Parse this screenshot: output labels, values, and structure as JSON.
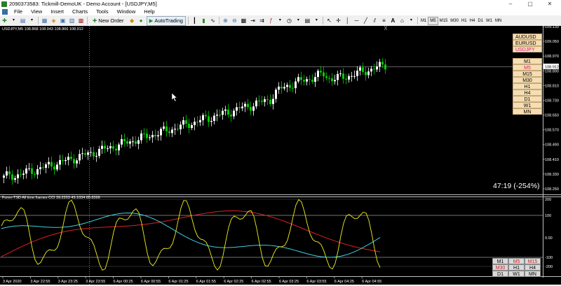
{
  "window": {
    "title": "2090373583: Tickmill-DemoUK - Demo Account - [USDJPY,M5]",
    "controls": [
      "–",
      "▢",
      "✕"
    ]
  },
  "menu": [
    "File",
    "View",
    "Insert",
    "Charts",
    "Tools",
    "Window",
    "Help"
  ],
  "toolbar": {
    "new_order": "New Order",
    "auto_trading": "AutoTrading",
    "timeframes": [
      "M1",
      "M5",
      "M15",
      "M30",
      "H1",
      "H4",
      "D1",
      "W1",
      "MN"
    ]
  },
  "chart": {
    "info": "USDJPY,M5  108.868 108.943 108.866 108.912",
    "countdown": "47:19 (-254%)",
    "current_price": "108.912",
    "price_labels": [
      "109.130",
      "109.050",
      "108.970",
      "108.890",
      "108.810",
      "108.730",
      "108.650",
      "108.570",
      "108.490",
      "108.410",
      "108.330",
      "108.250"
    ],
    "time_labels": [
      "3 Apr 2020",
      "3 Apr 22:55",
      "3 Apr 23:25",
      "3 Apr 23:55",
      "6 Apr 00:25",
      "6 Apr 00:55",
      "6 Apr 01:25",
      "6 Apr 01:55",
      "6 Apr 02:25",
      "6 Apr 02:55",
      "6 Apr 03:25",
      "6 Apr 03:55",
      "6 Apr 04:25",
      "6 Apr 04:55"
    ],
    "symbols": [
      "AUDUSD",
      "EURUSD",
      "USDJPY"
    ],
    "symbol_colors": [
      "#000000",
      "#000000",
      "#e0188c"
    ],
    "tf_panel": [
      "M1",
      "M5",
      "M15",
      "M30",
      "H1",
      "H4",
      "D1",
      "W1",
      "MN"
    ],
    "tf_active": "M5",
    "up_color": "#ffffff",
    "down_color": "#00cc00"
  },
  "indicator": {
    "info": "Forex-TSD All time frames CCI 39.2203 43.1034 85.8399",
    "levels": [
      "200",
      "100",
      "0.00",
      "-100",
      "-200"
    ],
    "grid": [
      "M1",
      "M5",
      "M15",
      "M30",
      "H1",
      "H4",
      "D1",
      "W1",
      "MN"
    ],
    "grid_red": [
      "M5",
      "M15",
      "M30"
    ]
  }
}
